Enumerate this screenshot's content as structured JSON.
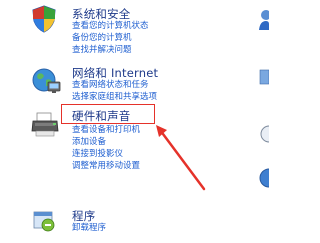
{
  "categories": [
    {
      "title": "系统和安全",
      "links": [
        "查看您的计算机状态",
        "备份您的计算机",
        "查找并解决问题"
      ]
    },
    {
      "title": "网络和 Internet",
      "links": [
        "查看网络状态和任务",
        "选择家庭组和共享选项"
      ]
    },
    {
      "title": "硬件和声音",
      "links": [
        "查看设备和打印机",
        "添加设备",
        "连接到投影仪",
        "调整常用移动设置"
      ]
    },
    {
      "title": "程序",
      "links": [
        "卸载程序"
      ]
    }
  ],
  "colors": {
    "title": "#1e3a8a",
    "link": "#1f5fd0",
    "annotation": "#e5322a"
  },
  "icons": [
    "security-shield-icon",
    "network-globe-icon",
    "printer-icon",
    "programs-icon"
  ]
}
